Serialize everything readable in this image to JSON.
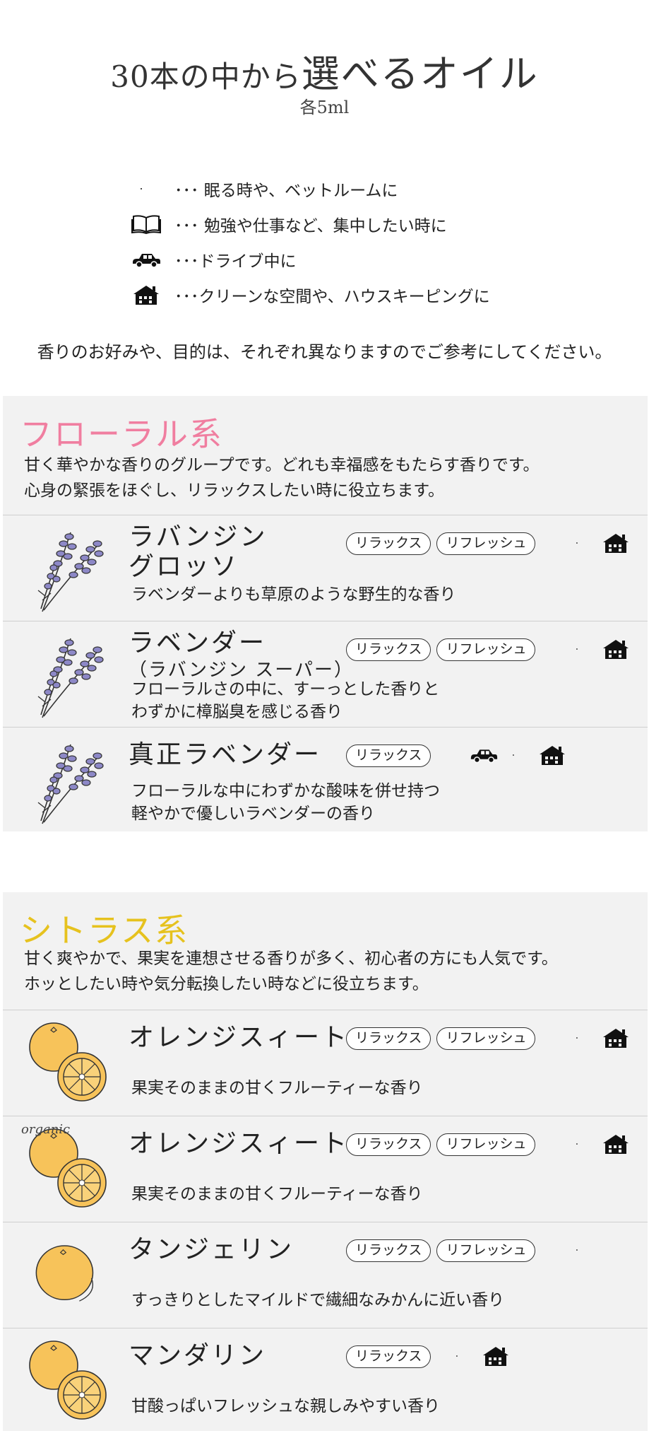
{
  "header": {
    "title_small": "30本の中から",
    "title_big": "選べるオイル",
    "subtitle": "各5ml"
  },
  "legend": [
    {
      "icon": "moon-icon",
      "text": "･･･ 眠る時や、ベットルームに"
    },
    {
      "icon": "book-icon",
      "text": "･･･ 勉強や仕事など、集中したい時に"
    },
    {
      "icon": "car-icon",
      "text": "･･･ドライブ中に"
    },
    {
      "icon": "house-icon",
      "text": "･･･クリーンな空間や、ハウスキーピングに"
    }
  ],
  "note": "香りのお好みや、目的は、それぞれ異なりますのでご参考にしてください。",
  "floral": {
    "title": "フローラル系",
    "desc_line1": "甘く華やかな香りのグループです。どれも幸福感をもたらす香りです。",
    "desc_line2": "心身の緊張をほぐし、リラックスしたい時に役立ちます。",
    "items": [
      {
        "name": "ラバンジン",
        "name2": "グロッソ",
        "tags": [
          "リラックス",
          "リフレッシュ"
        ],
        "icons": [
          "moon-icon",
          "house-icon"
        ],
        "desc1": "ラベンダーよりも草原のような野生的な香り",
        "desc2": ""
      },
      {
        "name": "ラベンダー",
        "sub": "（ラバンジン スーパー）",
        "tags": [
          "リラックス",
          "リフレッシュ"
        ],
        "icons": [
          "moon-icon",
          "house-icon"
        ],
        "desc1": "フローラルさの中に、すーっとした香りと",
        "desc2": "わずかに樟脳臭を感じる香り"
      },
      {
        "name": "真正ラベンダー",
        "tags": [
          "リラックス"
        ],
        "icons": [
          "car-icon",
          "moon-icon",
          "house-icon"
        ],
        "desc1": "フローラルな中にわずかな酸味を併せ持つ",
        "desc2": "軽やかで優しいラベンダーの香り"
      }
    ]
  },
  "citrus": {
    "title": "シトラス系",
    "desc_line1": "甘く爽やかで、果実を連想させる香りが多く、初心者の方にも人気です。",
    "desc_line2": "ホッとしたい時や気分転換したい時などに役立ちます。",
    "items": [
      {
        "name": "オレンジスィート",
        "tags": [
          "リラックス",
          "リフレッシュ"
        ],
        "icons": [
          "moon-icon",
          "house-icon"
        ],
        "desc1": "果実そのままの甘くフルーティーな香り"
      },
      {
        "name": "オレンジスィート",
        "badge": "organic",
        "tags": [
          "リラックス",
          "リフレッシュ"
        ],
        "icons": [
          "moon-icon",
          "house-icon"
        ],
        "desc1": "果実そのままの甘くフルーティーな香り"
      },
      {
        "name": "タンジェリン",
        "tags": [
          "リラックス",
          "リフレッシュ"
        ],
        "icons": [
          "moon-icon"
        ],
        "desc1": "すっきりとしたマイルドで繊細なみかんに近い香り"
      },
      {
        "name": "マンダリン",
        "tags": [
          "リラックス"
        ],
        "icons": [
          "moon-icon",
          "house-icon"
        ],
        "desc1": "甘酸っぱいフレッシュな親しみやすい香り"
      }
    ]
  },
  "colors": {
    "floral_title": "#f07ea0",
    "citrus_title": "#e6c21e",
    "section_bg": "#f2f2f2",
    "fruit": "#f7c35a",
    "lavender": "#7b76b8"
  }
}
